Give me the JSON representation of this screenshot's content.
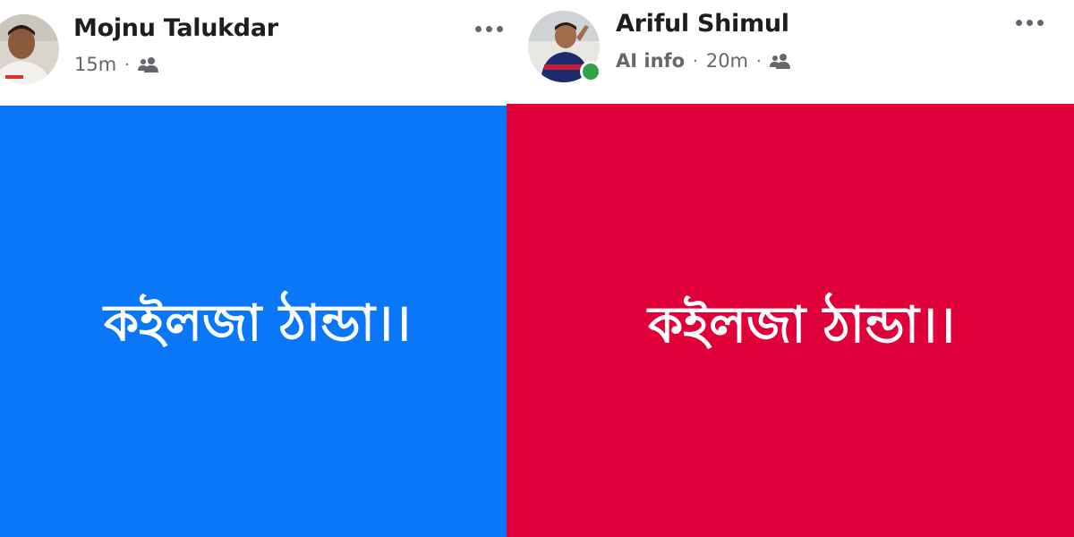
{
  "posts": [
    {
      "author": "Mojnu Talukdar",
      "time": "15m",
      "group": "",
      "audience_icon": "friends-icon",
      "more_icon": "more-options-icon",
      "card_text": "কইলজা ঠান্ডা।।",
      "card_color": "#0a76f8"
    },
    {
      "author": "Ariful Shimul",
      "time": "20m",
      "group": "AI info",
      "audience_icon": "friends-icon",
      "more_icon": "more-options-icon",
      "online": true,
      "card_text": "কইলজা ঠান্ডা।।",
      "card_color": "#e0013a"
    }
  ],
  "colors": {
    "text_primary": "#1c1e21",
    "text_secondary": "#65676b",
    "online": "#31a24c"
  },
  "separator": "·"
}
